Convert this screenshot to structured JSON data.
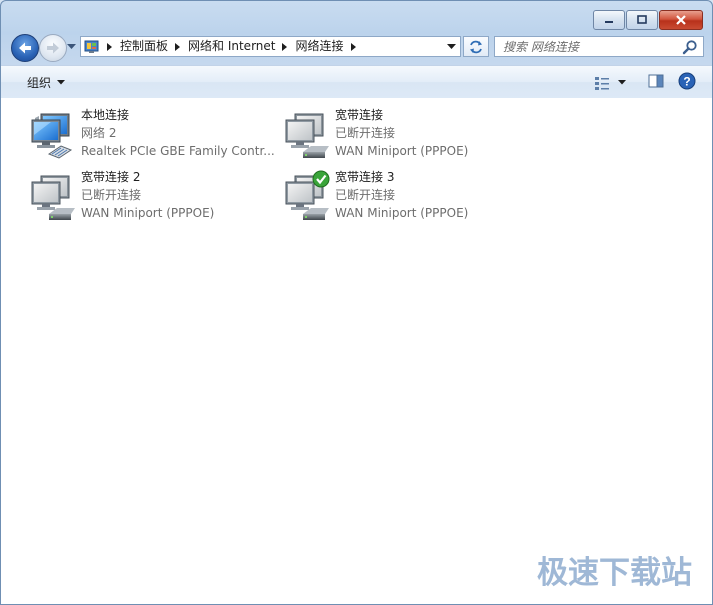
{
  "window": {
    "controls": {
      "minimize": "minimize",
      "maximize": "maximize",
      "close": "close"
    }
  },
  "address_bar": {
    "crumbs": [
      "控制面板",
      "网络和 Internet",
      "网络连接"
    ]
  },
  "search": {
    "placeholder": "搜索 网络连接"
  },
  "command_bar": {
    "organize_label": "组织"
  },
  "connections": [
    {
      "name": "本地连接",
      "status": "网络  2",
      "device": "Realtek PCIe GBE Family Contr...",
      "icon": "lan-connection-icon",
      "connected": true
    },
    {
      "name": "宽带连接",
      "status": "已断开连接",
      "device": "WAN Miniport (PPPOE)",
      "icon": "broadband-connection-icon",
      "connected": false
    },
    {
      "name": "宽带连接 2",
      "status": "已断开连接",
      "device": "WAN Miniport (PPPOE)",
      "icon": "broadband-connection-icon",
      "connected": false
    },
    {
      "name": "宽带连接 3",
      "status": "已断开连接",
      "device": "WAN Miniport (PPPOE)",
      "icon": "broadband-connection-default-icon",
      "connected": false
    }
  ],
  "watermark": "极速下载站",
  "colors": {
    "accent": "#2a63b6",
    "frame": "#bcd3ec",
    "check": "#3aa43a"
  }
}
